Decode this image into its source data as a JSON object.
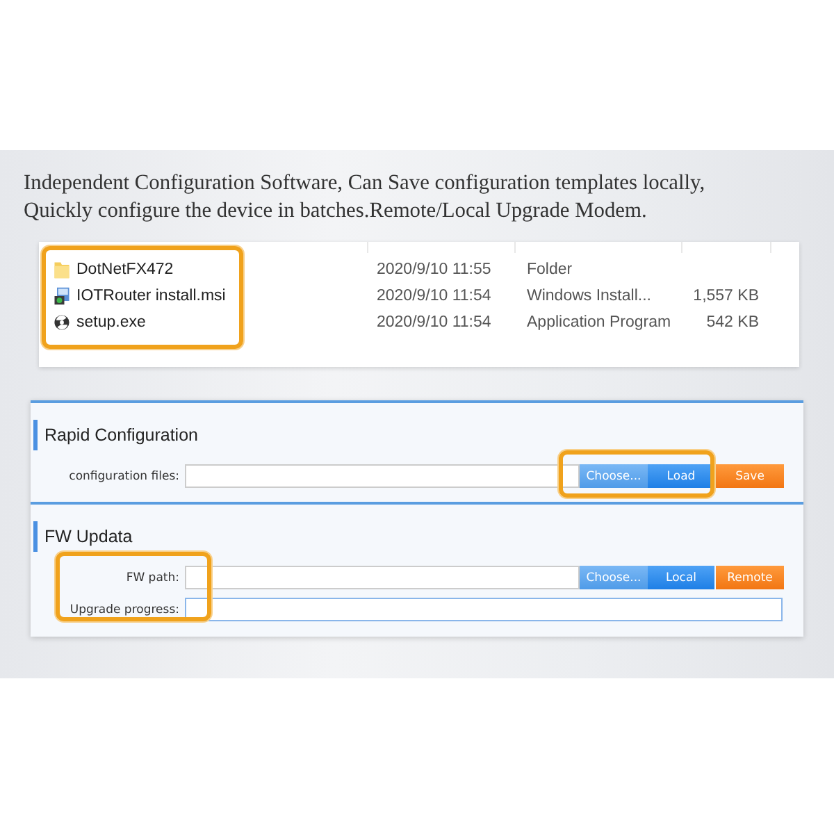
{
  "caption": "Independent Configuration Software, Can Save configuration templates locally, Quickly configure the device in batches.Remote/Local Upgrade Modem.",
  "files": [
    {
      "kind": "folder",
      "name": "DotNetFX472",
      "date": "2020/9/10 11:55",
      "type": "Folder"
    },
    {
      "kind": "installer",
      "name": "IOTRouter install.msi",
      "date": "2020/9/10 11:54",
      "type": "Windows Install...",
      "size": "1,557 KB"
    },
    {
      "kind": "setup",
      "name": "setup.exe",
      "date": "2020/9/10 11:54",
      "type": "Application Program",
      "size": "542 KB"
    }
  ],
  "sections": [
    {
      "title": "Rapid Configuration",
      "rows": [
        {
          "kind": "file",
          "label": "configuration files:",
          "buttons": [
            {
              "kind": "light",
              "label": "Choose..."
            },
            {
              "kind": "blue",
              "label": "Load"
            },
            {
              "kind": "orange",
              "label": "Save"
            }
          ]
        }
      ]
    },
    {
      "title": "FW Updata",
      "rows": [
        {
          "kind": "file",
          "label": "FW path:",
          "buttons": [
            {
              "kind": "light",
              "label": "Choose..."
            },
            {
              "kind": "blue",
              "label": "Local"
            },
            {
              "kind": "orange",
              "label": "Remote"
            }
          ]
        },
        {
          "kind": "progress",
          "label": "Upgrade progress:"
        }
      ]
    }
  ]
}
